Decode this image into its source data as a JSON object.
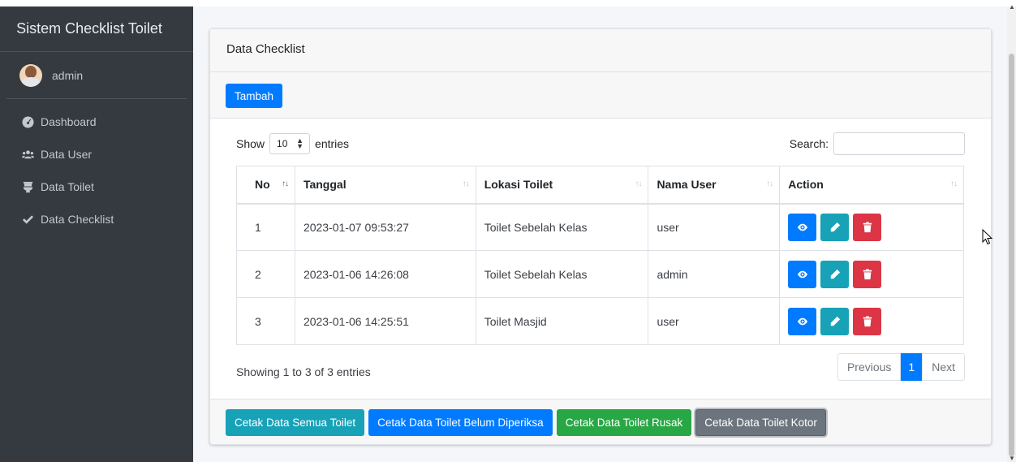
{
  "app": {
    "brand": "Sistem Checklist Toilet",
    "user": "admin"
  },
  "sidebar": {
    "items": [
      {
        "label": "Dashboard",
        "icon": "tachometer-icon"
      },
      {
        "label": "Data User",
        "icon": "users-icon"
      },
      {
        "label": "Data Toilet",
        "icon": "toilet-icon"
      },
      {
        "label": "Data Checklist",
        "icon": "check-icon"
      }
    ]
  },
  "card": {
    "title": "Data Checklist",
    "add_label": "Tambah"
  },
  "datatable": {
    "show_label": "Show",
    "entries_value": "10",
    "entries_label": "entries",
    "search_label": "Search:",
    "columns": [
      "No",
      "Tanggal",
      "Lokasi Toilet",
      "Nama User",
      "Action"
    ],
    "rows": [
      {
        "no": "1",
        "tanggal": "2023-01-07 09:53:27",
        "lokasi": "Toilet Sebelah Kelas",
        "nama": "user"
      },
      {
        "no": "2",
        "tanggal": "2023-01-06 14:26:08",
        "lokasi": "Toilet Sebelah Kelas",
        "nama": "admin"
      },
      {
        "no": "3",
        "tanggal": "2023-01-06 14:25:51",
        "lokasi": "Toilet Masjid",
        "nama": "user"
      }
    ],
    "info": "Showing 1 to 3 of 3 entries",
    "pagination": {
      "previous": "Previous",
      "current": "1",
      "next": "Next"
    }
  },
  "footer_buttons": {
    "semua": "Cetak Data Semua Toilet",
    "belum": "Cetak Data Toilet Belum Diperiksa",
    "rusak": "Cetak Data Toilet Rusak",
    "kotor": "Cetak Data Toilet Kotor"
  },
  "colors": {
    "primary": "#007bff",
    "info": "#17a2b8",
    "success": "#28a745",
    "secondary": "#6c757d",
    "danger": "#dc3545",
    "sidebar": "#343a40"
  }
}
